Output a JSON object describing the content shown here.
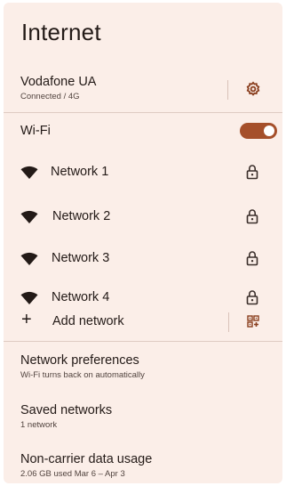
{
  "page": {
    "title": "Internet"
  },
  "carrier": {
    "name": "Vodafone UA",
    "status": "Connected / 4G",
    "settings_icon": "gear-icon"
  },
  "wifi": {
    "label": "Wi-Fi",
    "enabled": true
  },
  "networks": [
    {
      "label": "Network 1",
      "secured": true
    },
    {
      "label": "Network 2",
      "secured": true
    },
    {
      "label": "Network 3",
      "secured": true
    },
    {
      "label": "Network 4",
      "secured": true
    }
  ],
  "add_network": {
    "label": "Add network",
    "icon": "plus-icon",
    "qr_icon": "qr-code-icon"
  },
  "preferences": [
    {
      "title": "Network preferences",
      "subtitle": "Wi-Fi turns back on automatically"
    },
    {
      "title": "Saved networks",
      "subtitle": "1 network"
    },
    {
      "title": "Non-carrier data usage",
      "subtitle": "2.06 GB used Mar 6 – Apr 3"
    }
  ],
  "colors": {
    "background": "#fbeee8",
    "accent": "#a54f2a",
    "text": "#231a17"
  }
}
